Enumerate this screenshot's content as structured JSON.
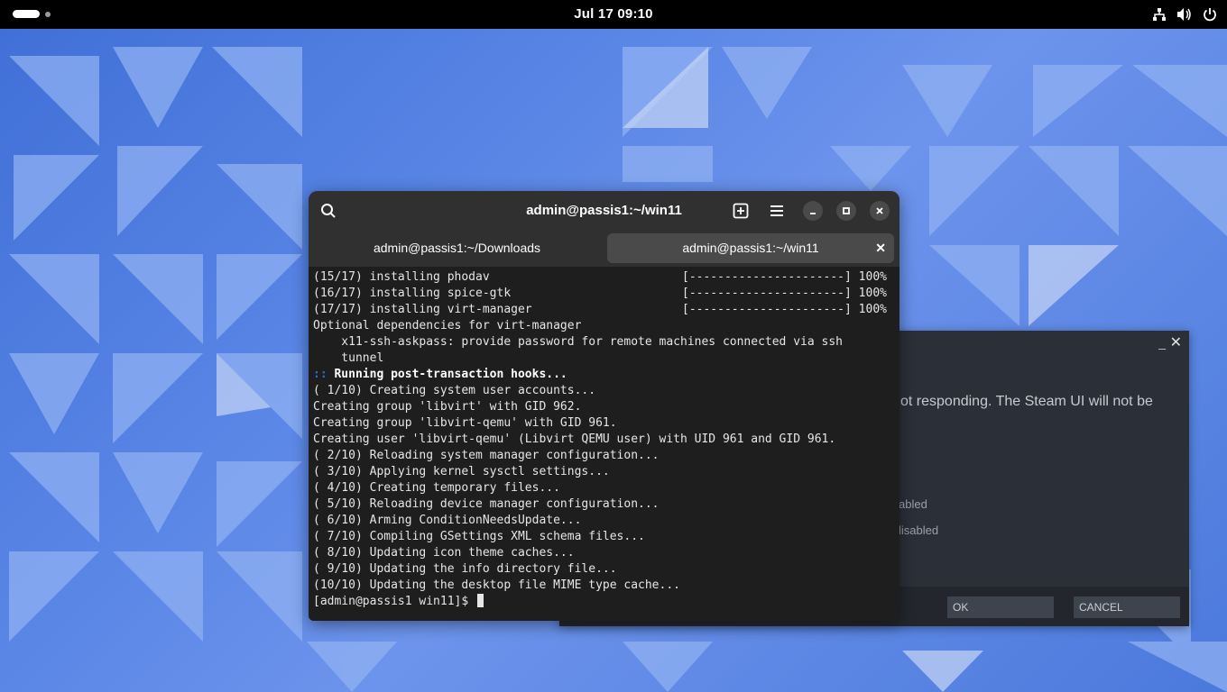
{
  "topbar": {
    "clock": "Jul 17  09:10",
    "tray_icons": [
      "network-icon",
      "volume-icon",
      "power-icon"
    ]
  },
  "terminal": {
    "title": "admin@passis1:~/win11",
    "tabs": [
      {
        "label": "admin@passis1:~/Downloads",
        "active": false
      },
      {
        "label": "admin@passis1:~/win11",
        "active": true
      }
    ],
    "lines": [
      {
        "text": "(15/17) installing phodav",
        "progress": "[----------------------] 100%"
      },
      {
        "text": "(16/17) installing spice-gtk",
        "progress": "[----------------------] 100%"
      },
      {
        "text": "(17/17) installing virt-manager",
        "progress": "[----------------------] 100%"
      },
      {
        "text": "Optional dependencies for virt-manager"
      },
      {
        "text": "    x11-ssh-askpass: provide password for remote machines connected via ssh"
      },
      {
        "text": "    tunnel"
      },
      {
        "prefix": "::",
        "text": " Running post-transaction hooks...",
        "bold": true
      },
      {
        "text": "( 1/10) Creating system user accounts..."
      },
      {
        "text": "Creating group 'libvirt' with GID 962."
      },
      {
        "text": "Creating group 'libvirt-qemu' with GID 961."
      },
      {
        "text": "Creating user 'libvirt-qemu' (Libvirt QEMU user) with UID 961 and GID 961."
      },
      {
        "text": "( 2/10) Reloading system manager configuration..."
      },
      {
        "text": "( 3/10) Applying kernel sysctl settings..."
      },
      {
        "text": "( 4/10) Creating temporary files..."
      },
      {
        "text": "( 5/10) Reloading device manager configuration..."
      },
      {
        "text": "( 6/10) Arming ConditionNeedsUpdate..."
      },
      {
        "text": "( 7/10) Compiling GSettings XML schema files..."
      },
      {
        "text": "( 8/10) Updating icon theme caches..."
      },
      {
        "text": "( 9/10) Updating the info directory file..."
      },
      {
        "text": "(10/10) Updating the desktop file MIME type cache..."
      }
    ],
    "prompt": "[admin@passis1 win11]$ "
  },
  "steam_dialog": {
    "message": "ot responding. The Steam UI will not be",
    "option1": "abled",
    "option2": "lisabled",
    "ok_label": "OK",
    "cancel_label": "CANCEL",
    "minimize_label": "_",
    "close_label": "✕"
  },
  "colors": {
    "terminal_bg": "#1e1e1e",
    "headerbar_bg": "#303030",
    "accent_blue": "#2f6bd8",
    "steam_bg": "#2a2f36"
  }
}
